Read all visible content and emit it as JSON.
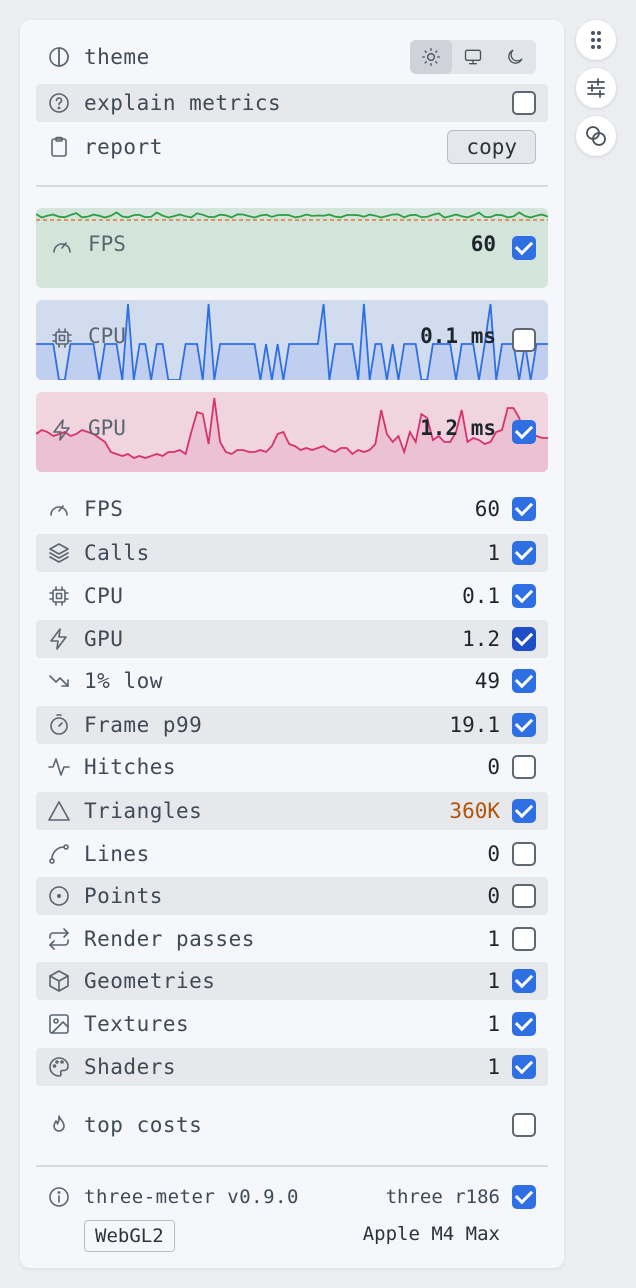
{
  "header": {
    "theme_label": "theme",
    "theme_options": [
      "light",
      "system",
      "dark"
    ],
    "theme_selected": "light",
    "explain_label": "explain metrics",
    "explain_checked": false,
    "report_label": "report",
    "copy_label": "copy"
  },
  "graphs": {
    "fps": {
      "label": "FPS",
      "value": "60",
      "checked": true,
      "color": "#2e9e45",
      "bg": "#d3e5da"
    },
    "cpu": {
      "label": "CPU",
      "value": "0.1 ms",
      "checked": false,
      "color": "#2f6fe4",
      "bg": "#d2dcef"
    },
    "gpu": {
      "label": "GPU",
      "value": "1.2 ms",
      "checked": true,
      "color": "#d6336c",
      "bg": "#f0d5df"
    }
  },
  "metrics": [
    {
      "icon": "gauge-icon",
      "label": "FPS",
      "value": "60",
      "checked": true
    },
    {
      "icon": "layers-icon",
      "label": "Calls",
      "value": "1",
      "checked": true
    },
    {
      "icon": "cpu-icon",
      "label": "CPU",
      "value": "0.1",
      "checked": true
    },
    {
      "icon": "zap-icon",
      "label": "GPU",
      "value": "1.2",
      "checked": true
    },
    {
      "icon": "trending-down-icon",
      "label": "1% low",
      "value": "49",
      "checked": true
    },
    {
      "icon": "timer-icon",
      "label": "Frame p99",
      "value": "19.1",
      "checked": true
    },
    {
      "icon": "activity-icon",
      "label": "Hitches",
      "value": "0",
      "checked": false
    },
    {
      "icon": "triangle-icon",
      "label": "Triangles",
      "value": "360K",
      "checked": true,
      "warn_color": "#b3540a"
    },
    {
      "icon": "spline-icon",
      "label": "Lines",
      "value": "0",
      "checked": false
    },
    {
      "icon": "circle-dot-icon",
      "label": "Points",
      "value": "0",
      "checked": false
    },
    {
      "icon": "repeat-icon",
      "label": "Render passes",
      "value": "1",
      "checked": false
    },
    {
      "icon": "box-icon",
      "label": "Geometries",
      "value": "1",
      "checked": true
    },
    {
      "icon": "image-icon",
      "label": "Textures",
      "value": "1",
      "checked": true
    },
    {
      "icon": "palette-icon",
      "label": "Shaders",
      "value": "1",
      "checked": true
    }
  ],
  "top_costs": {
    "label": "top costs",
    "checked": false
  },
  "footer": {
    "version": "three-meter v0.9.0",
    "three_rev": "three r186",
    "three_checked": true,
    "backend": "WebGL2",
    "gpu_name": "Apple M4 Max"
  },
  "side_buttons": [
    "drag-handle-icon",
    "sliders-icon",
    "overlap-icon"
  ],
  "colors": {
    "accent": "#2f6fe4",
    "warn": "#b3540a"
  }
}
